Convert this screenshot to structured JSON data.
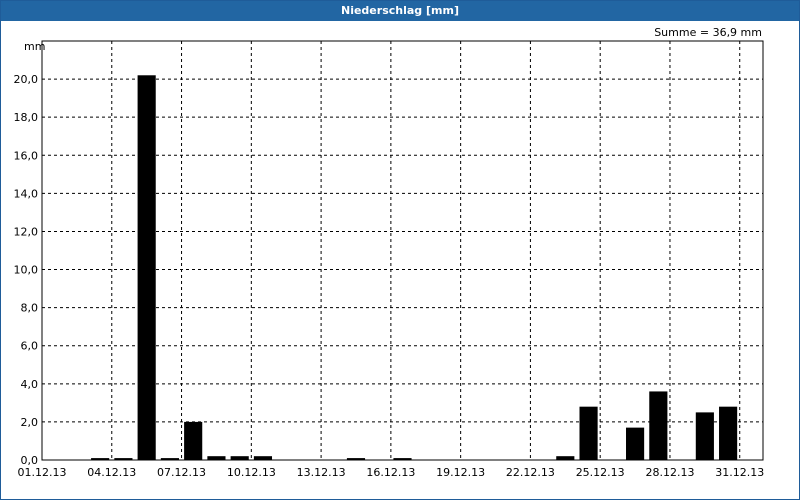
{
  "window": {
    "title": "Niederschlag [mm]"
  },
  "chart_data": {
    "type": "bar",
    "title": "Niederschlag [mm]",
    "ylabel": "mm",
    "sum_label": "Summe = 36,9 mm",
    "ylim": [
      0,
      22
    ],
    "y_ticks": [
      "0,0",
      "2,0",
      "4,0",
      "6,0",
      "8,0",
      "10,0",
      "12,0",
      "14,0",
      "16,0",
      "18,0",
      "20,0"
    ],
    "x_tick_labels": [
      "01.12.13",
      "04.12.13",
      "07.12.13",
      "10.12.13",
      "13.12.13",
      "16.12.13",
      "19.12.13",
      "22.12.13",
      "25.12.13",
      "28.12.13",
      "31.12.13"
    ],
    "grid": true,
    "bar_color": "#000000",
    "categories": [
      "01.12.13",
      "02.12.13",
      "03.12.13",
      "04.12.13",
      "05.12.13",
      "06.12.13",
      "07.12.13",
      "08.12.13",
      "09.12.13",
      "10.12.13",
      "11.12.13",
      "12.12.13",
      "13.12.13",
      "14.12.13",
      "15.12.13",
      "16.12.13",
      "17.12.13",
      "18.12.13",
      "19.12.13",
      "20.12.13",
      "21.12.13",
      "22.12.13",
      "23.12.13",
      "24.12.13",
      "25.12.13",
      "26.12.13",
      "27.12.13",
      "28.12.13",
      "29.12.13",
      "30.12.13",
      "31.12.13"
    ],
    "values": [
      0,
      0,
      0.1,
      0.1,
      20.2,
      0.1,
      2.0,
      0.2,
      0.2,
      0.2,
      0,
      0,
      0,
      0.1,
      0,
      0.1,
      0,
      0,
      0,
      0,
      0,
      0,
      0.2,
      2.8,
      0,
      1.7,
      3.6,
      0,
      2.5,
      2.8,
      0
    ]
  }
}
